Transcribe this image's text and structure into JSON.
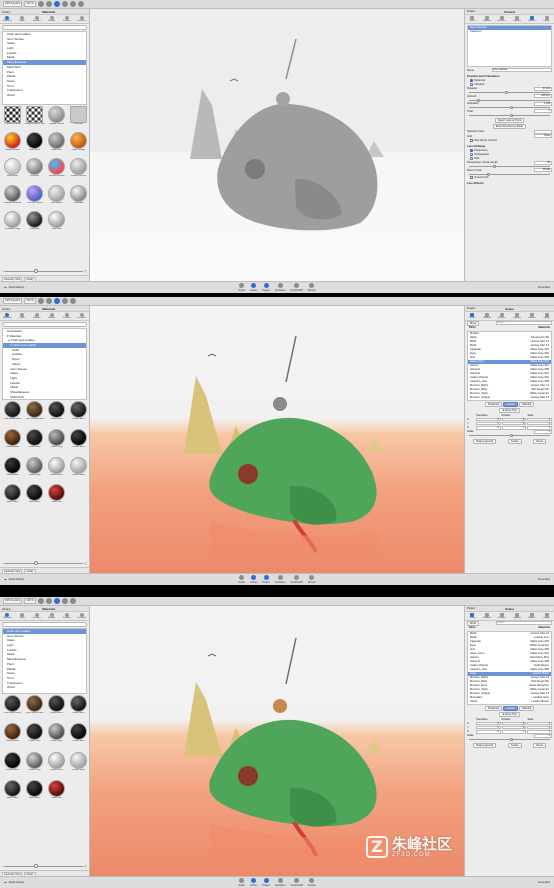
{
  "toolbar": {
    "app_menu": "KPS Keyshot",
    "zoom": "100 %",
    "buttons": [
      "◀",
      "▶",
      "▦",
      "▦",
      "▦"
    ]
  },
  "library": {
    "title": "Library",
    "header_title": "Materials",
    "tabs": [
      "Materials",
      "Colors",
      "Environ.",
      "Backpl.",
      "Textures",
      "Favorites"
    ],
    "search_placeholder": "",
    "bottom_tabs": [
      "Geometry View",
      "Library"
    ]
  },
  "bottom": {
    "cloud": "Cloud Library",
    "items": [
      "Import",
      "Library",
      "Project",
      "Animation",
      "KeyShotXR",
      "Render"
    ],
    "screenshot": "Screenshot"
  },
  "shot1": {
    "categories": [
      "Cloth and Leather",
      "Gem Stones",
      "Glass",
      "Light",
      "Liquids",
      "Metal",
      "Miscellaneous",
      "Mold-Tech",
      "Paint",
      "Plastic",
      "Stone",
      "Toon",
      "Translucent",
      "Wood"
    ],
    "selected_index": 6,
    "thumbs": [
      {
        "label": "Checker Material",
        "c1": "#ffffff",
        "c2": "#222222",
        "kind": "checker"
      },
      {
        "label": "Checker Material Tank",
        "c1": "#ffffff",
        "c2": "#333333",
        "kind": "checker"
      },
      {
        "label": "Shadow Catcher",
        "c1": "#d8d8d8",
        "c2": "#8a8a8a",
        "kind": "sphere"
      },
      {
        "label": "Flat Grey",
        "c1": "#c9c9c9",
        "c2": "#c9c9c9",
        "kind": "flat"
      },
      {
        "label": "Infrared Ground",
        "c1": "#ffd020",
        "c2": "#d01818",
        "kind": "sphere"
      },
      {
        "label": "Matte Black",
        "c1": "#444444",
        "c2": "#000000",
        "kind": "sphere"
      },
      {
        "label": "Matte Grey",
        "c1": "#cccccc",
        "c2": "#666666",
        "kind": "sphere"
      },
      {
        "label": "Matte Orange",
        "c1": "#ffb347",
        "c2": "#c0540a",
        "kind": "sphere"
      },
      {
        "label": "Matte White",
        "c1": "#ffffff",
        "c2": "#bdbdbd",
        "kind": "sphere"
      },
      {
        "label": "Occlusion",
        "c1": "#e6e6e6",
        "c2": "#777777",
        "kind": "sphere"
      },
      {
        "label": "Rainbow Ground",
        "c1": "#40c0ff",
        "c2": "#ff4040",
        "kind": "sphere"
      },
      {
        "label": "Shadow Catcher",
        "c1": "#eeeeee",
        "c2": "#9a9a9a",
        "kind": "sphere"
      },
      {
        "label": "Shaded Wireframe",
        "c1": "#d0d0d0",
        "c2": "#555555",
        "kind": "sphere"
      },
      {
        "label": "Thin Film Ground",
        "c1": "#c8a0ff",
        "c2": "#4060c0",
        "kind": "sphere"
      },
      {
        "label": "Toon Ground",
        "c1": "#f0f0f0",
        "c2": "#a0a0a0",
        "kind": "sphere"
      },
      {
        "label": "Wireframe",
        "c1": "#f5f5f5",
        "c2": "#888888",
        "kind": "sphere"
      },
      {
        "label": "Wireframe Large",
        "c1": "#ffffff",
        "c2": "#9a9a9a",
        "kind": "sphere"
      },
      {
        "label": "Grey Black",
        "c1": "#999999",
        "c2": "#111111",
        "kind": "sphere"
      },
      {
        "label": "Grey White",
        "c1": "#ffffff",
        "c2": "#999999",
        "kind": "sphere"
      }
    ]
  },
  "shot2": {
    "tree": [
      "Downloads",
      "▾ Materials",
      "  ▸ Cloth and Leather",
      "    ▸ Cloth and Leather",
      "      Cloth",
      "      Leather",
      "      Nylon",
      "      Velvet",
      "    Gem Stones",
      "    Glass",
      "    Light",
      "    Liquids",
      "    Metal",
      "    Miscellaneous",
      "    Mold-Tech"
    ],
    "selected_index": 3,
    "thumbs": [
      {
        "label": "Cloth Weave Black",
        "c1": "#5a5a5a",
        "c2": "#111111"
      },
      {
        "label": "Cloth Weave Brown",
        "c1": "#8a6a4a",
        "c2": "#3a2410"
      },
      {
        "label": "Leather Black",
        "c1": "#555555",
        "c2": "#0a0a0a"
      },
      {
        "label": "Leather Black",
        "c1": "#666666",
        "c2": "#111111"
      },
      {
        "label": "Leather Brown",
        "c1": "#9a6840",
        "c2": "#3a1e08"
      },
      {
        "label": "Leather Dark",
        "c1": "#4a4a4a",
        "c2": "#0a0a0a"
      },
      {
        "label": "Leather Grey",
        "c1": "#b8b8b8",
        "c2": "#444444"
      },
      {
        "label": "Leather Black",
        "c1": "#444444",
        "c2": "#000000"
      },
      {
        "label": "Leather Black",
        "c1": "#3a3a3a",
        "c2": "#000000"
      },
      {
        "label": "Leather Grey",
        "c1": "#cccccc",
        "c2": "#555555"
      },
      {
        "label": "Leather White",
        "c1": "#ffffff",
        "c2": "#9a9a9a"
      },
      {
        "label": "Leather White",
        "c1": "#f5f5f5",
        "c2": "#a0a0a0"
      },
      {
        "label": "Nylon Fabric",
        "c1": "#666666",
        "c2": "#111111"
      },
      {
        "label": "Velvet Black",
        "c1": "#444444",
        "c2": "#050505"
      },
      {
        "label": "Velvet Red",
        "c1": "#e04040",
        "c2": "#500808"
      }
    ]
  },
  "shot3": {
    "categories": [
      "Cloth and Leather",
      "Gem Stones",
      "Glass",
      "Light",
      "Liquids",
      "Metal",
      "Miscellaneous",
      "Paint",
      "Plastic",
      "Stone",
      "Toon",
      "Translucent",
      "Wood"
    ],
    "selected_index": 0,
    "thumbs": [
      {
        "label": "Cloth Weave Black",
        "c1": "#5a5a5a",
        "c2": "#111111"
      },
      {
        "label": "Cloth Weave Brown",
        "c1": "#8a6a4a",
        "c2": "#3a2410"
      },
      {
        "label": "Leather Black",
        "c1": "#555555",
        "c2": "#0a0a0a"
      },
      {
        "label": "Leather Black",
        "c1": "#666666",
        "c2": "#111111"
      },
      {
        "label": "Leather Brown",
        "c1": "#9a6840",
        "c2": "#3a1e08"
      },
      {
        "label": "Leather Dark",
        "c1": "#4a4a4a",
        "c2": "#0a0a0a"
      },
      {
        "label": "Leather Grey",
        "c1": "#cccccc",
        "c2": "#444444"
      },
      {
        "label": "Leather Black",
        "c1": "#444444",
        "c2": "#000000"
      },
      {
        "label": "Leather Black",
        "c1": "#3a3a3a",
        "c2": "#000000"
      },
      {
        "label": "Leather Grey",
        "c1": "#d5d5d5",
        "c2": "#555555"
      },
      {
        "label": "Leather White",
        "c1": "#ffffff",
        "c2": "#9a9a9a"
      },
      {
        "label": "Leather White",
        "c1": "#f5f5f5",
        "c2": "#a0a0a0"
      },
      {
        "label": "Nylon Fabric",
        "c1": "#666666",
        "c2": "#111111"
      },
      {
        "label": "Velvet Black",
        "c1": "#444444",
        "c2": "#050505"
      },
      {
        "label": "Velvet Red",
        "c1": "#e04040",
        "c2": "#500808"
      }
    ]
  },
  "camera_panel": {
    "project": "Project",
    "title": "Camera",
    "tabs": [
      "Scene",
      "Material",
      "Environ.",
      "Lighting",
      "Camera",
      "Image"
    ],
    "list": [
      "Free Camera",
      "Camera 1"
    ],
    "name_label": "Name",
    "name_value": "Free Camera",
    "section1": "Position and Orientation",
    "radio1": [
      "Spherical",
      "Absolute"
    ],
    "fields1": [
      {
        "label": "Distance",
        "value": "67.442"
      },
      {
        "label": "Azimuth",
        "value": "-146.327"
      },
      {
        "label": "Inclination",
        "value": "1.645"
      },
      {
        "label": "Twist",
        "value": "0"
      }
    ],
    "btn_lookat": "Select 'Look at' Point",
    "btn_enter": "Enter First Person Mode",
    "fields2": [
      {
        "label": "Standard View",
        "value": ""
      },
      {
        "label": "Grid",
        "value": "None"
      }
    ],
    "check_ground": "Stay Above Ground",
    "section2": "Lens Settings",
    "radio2": [
      "Perspective",
      "Orthographic",
      "Shift"
    ],
    "fields3": [
      {
        "label": "Perspective / Focal Length",
        "value": "50"
      },
      {
        "label": "Field of View",
        "value": "39.598"
      }
    ],
    "check_guides": "Ground Grid",
    "section3": "Lens Effects"
  },
  "scene2": {
    "project": "Project",
    "title": "Scene",
    "tabs": [
      "Scene",
      "Material",
      "Environ.",
      "Lighting",
      "Camera",
      "Image"
    ],
    "show": "Show",
    "search": "Search",
    "col_parts": "Parts",
    "col_materials": "Materials",
    "rows": [
      {
        "name": "Models",
        "mat": ""
      },
      {
        "name": "Water",
        "mat": "Translucent Wa"
      },
      {
        "name": "Bird1",
        "mat": "Human Skin 14"
      },
      {
        "name": "Bird2",
        "mat": "Human Skin 14"
      },
      {
        "name": "Cigarette",
        "mat": "Matte Grey #23"
      },
      {
        "name": "Eyes",
        "mat": "Matte Grey #18"
      },
      {
        "name": "Gun",
        "mat": "Matte Grey #09"
      },
      {
        "name": "Head_Arms",
        "mat": "Matte Grey #12"
      },
      {
        "name": "Helmet",
        "mat": "Matte Grey #07"
      },
      {
        "name": "Helmet1",
        "mat": "Matte Grey #08"
      },
      {
        "name": "Helmet2",
        "mat": "Matte Grey #10"
      },
      {
        "name": "Jacket_Parrots",
        "mat": "Matte Grey #16"
      },
      {
        "name": "Lanterns_Gun",
        "mat": "Matte Grey #05"
      },
      {
        "name": "Monster_Barbs",
        "mat": "Human Skin 14"
      },
      {
        "name": "Monster_Body",
        "mat": "Soft Rough Mo"
      },
      {
        "name": "Monster_Teeth",
        "mat": "White Ceramics"
      },
      {
        "name": "Monster_Tongue",
        "mat": "Human Skin 14"
      }
    ],
    "selected_index": 7,
    "prop_tabs": [
      "Properties",
      "Position",
      "Material"
    ],
    "move_tool": "Move Tool",
    "xf_headers": [
      "Translation",
      "Rotation",
      "Scale"
    ],
    "xf_rows": [
      {
        "axis": "X",
        "t": "0",
        "r": "0",
        "s": "1"
      },
      {
        "axis": "Y",
        "t": "0",
        "r": "0",
        "s": "1"
      },
      {
        "axis": "Z",
        "t": "0",
        "r": "0",
        "s": "1"
      }
    ],
    "scale_label": "Scale",
    "buttons": [
      "Snap to ground",
      "Center",
      "Reset"
    ]
  },
  "scene3": {
    "rows": [
      {
        "name": "Bird2",
        "mat": "Human Skin 14"
      },
      {
        "name": "Bottle",
        "mat": "Leather Gun"
      },
      {
        "name": "Cigarette",
        "mat": "Matte Grey #23"
      },
      {
        "name": "Eyes",
        "mat": "White Ceramics"
      },
      {
        "name": "Gun",
        "mat": "Matte Grey #09"
      },
      {
        "name": "Head_Arms",
        "mat": "Matte Grey #12"
      },
      {
        "name": "Helmet",
        "mat": "Hard Shiny Plas"
      },
      {
        "name": "Helmet1",
        "mat": "Matte Grey #08"
      },
      {
        "name": "Jacket_Parrots",
        "mat": "Cloth Weave"
      },
      {
        "name": "Lanterns_Gun",
        "mat": "Matte Grey #05"
      },
      {
        "name": "Legs",
        "mat": "Leather Black"
      },
      {
        "name": "Monster_Barbs",
        "mat": "Human Skin 14"
      },
      {
        "name": "Monster_Body",
        "mat": "Soft Rough Mo"
      },
      {
        "name": "Monster_Eyes",
        "mat": "Glass Refraction"
      },
      {
        "name": "Monster_Teeth",
        "mat": "White Ceramics"
      },
      {
        "name": "Monster_Tongue",
        "mat": "Human Skin 14"
      },
      {
        "name": "Mountains",
        "mat": "Leather Grey"
      },
      {
        "name": "Shoes",
        "mat": "Leather Brown"
      }
    ],
    "selected_index": 10
  },
  "watermark": {
    "brand": "朱峰社区",
    "domain": "ZF3D.COM",
    "logo": "Z"
  },
  "colors": {
    "accent": "#2f6fd1",
    "selection": "#6b95d6",
    "monster_green": "#4fa65a",
    "sand": "#d9c27a",
    "water_orange": "#f2a07e"
  }
}
